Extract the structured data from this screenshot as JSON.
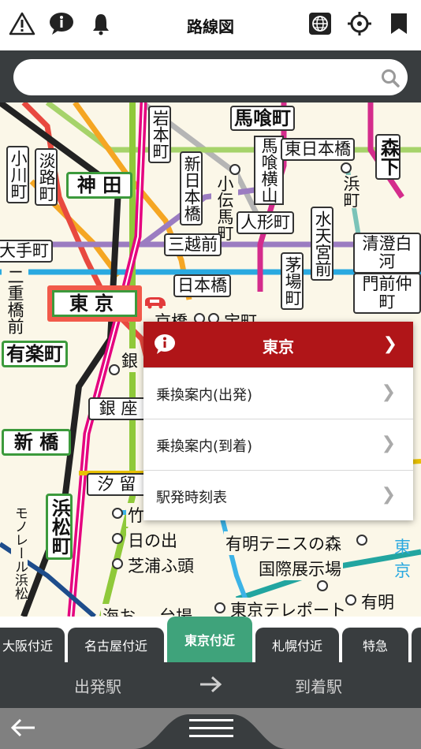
{
  "header": {
    "title": "路線図",
    "icons": [
      "warning-icon",
      "info-icon",
      "bell-icon",
      "globe-icon",
      "crosshair-icon",
      "bookmark-icon"
    ]
  },
  "search": {
    "value": "",
    "placeholder": ""
  },
  "map": {
    "stations": {
      "bakurocho": "馬喰町",
      "iwamotocho": "岩本町",
      "kanda": "神 田",
      "ogawamachi": "小川町",
      "awajicho": "淡路町",
      "shinnihonbashi": "新日本橋",
      "kodenmacho": "小伝馬町",
      "bakuroyokoyama": "馬喰横山",
      "higashinihonbashi": "東日本橋",
      "hamacho": "浜町",
      "morishita": "森下",
      "ningyocho": "人形町",
      "suitengumae": "水天宮前",
      "mitsukoshimae": "三越前",
      "otemachi": "大手町",
      "kiyosumi": "清澄白河",
      "nijubashimae": "二重橋前",
      "nihonbashi": "日本橋",
      "kayabacho": "茅場町",
      "monzen": "門前仲町",
      "tokyo": "東京",
      "kyobashi": "京橋",
      "takaracho": "宝町",
      "yurakucho": "有楽町",
      "ginza_partial": "銀",
      "ginza": "銀 座",
      "shinbashi": "新 橋",
      "shiodome": "汐 留",
      "hamamatsucho": "浜松町",
      "monorail": "モノレール浜松",
      "takeshiba": "竹",
      "hinode": "日の出",
      "shibaurafuto": "芝浦ふ頭",
      "ariake_tennis": "有明テニスの森",
      "kokusai": "国際展示場",
      "teleport": "東京テレポート",
      "ariake": "有明",
      "daiba": "台場",
      "kaihin": "海お",
      "tokyo_partial": "東京"
    }
  },
  "popup": {
    "station": "東京",
    "items": [
      {
        "label": "乗換案内(出発)"
      },
      {
        "label": "乗換案内(到着)"
      },
      {
        "label": "駅発時刻表"
      }
    ]
  },
  "tabs": [
    {
      "label": "大阪付近",
      "active": false
    },
    {
      "label": "名古屋付近",
      "active": false
    },
    {
      "label": "東京付近",
      "active": true
    },
    {
      "label": "札幌付近",
      "active": false
    },
    {
      "label": "特急",
      "active": false
    }
  ],
  "od": {
    "from": "出発駅",
    "to": "到着駅"
  },
  "colors": {
    "header_dark": "#393d3f",
    "popup_red": "#b01518",
    "tab_active": "#3fa37b",
    "map_bg": "#fbf7e8",
    "station_green": "#3c9a3c"
  }
}
